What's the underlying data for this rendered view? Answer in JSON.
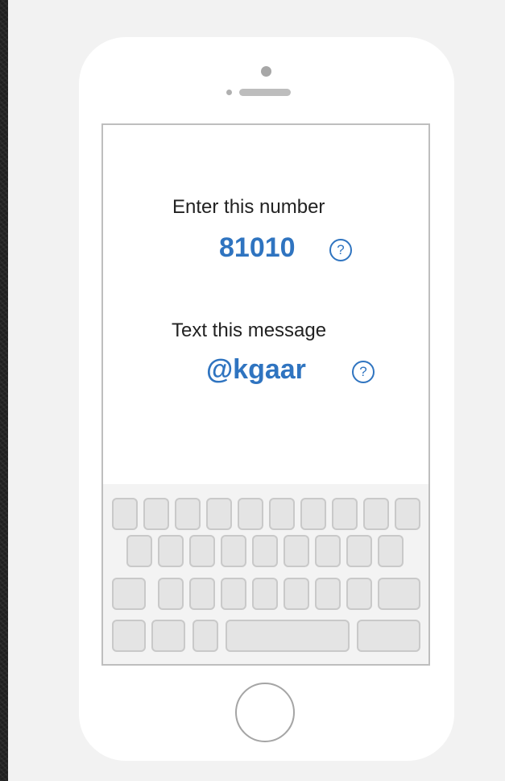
{
  "instructions": {
    "number_label": "Enter this number",
    "number_value": "81010",
    "message_label": "Text this message",
    "message_value": "@kgaar",
    "help_glyph": "?"
  },
  "icons": {
    "help": "question-circle-icon",
    "home": "home-button-circle"
  },
  "colors": {
    "accent": "#2f74c0",
    "panel": "#f2f2f2",
    "phone_body": "#ffffff",
    "key_fill": "#e4e4e4",
    "key_border": "#c9c9c9"
  },
  "keyboard": {
    "rows": [
      [
        "key",
        "key",
        "key",
        "key",
        "key",
        "key",
        "key",
        "key",
        "key",
        "key"
      ],
      [
        "key",
        "key",
        "key",
        "key",
        "key",
        "key",
        "key",
        "key",
        "key"
      ],
      [
        "key",
        "key",
        "key",
        "key",
        "key",
        "key",
        "key",
        "key",
        "wide-key"
      ],
      [
        "key",
        "key",
        "key",
        "space",
        "wide-key"
      ]
    ]
  }
}
